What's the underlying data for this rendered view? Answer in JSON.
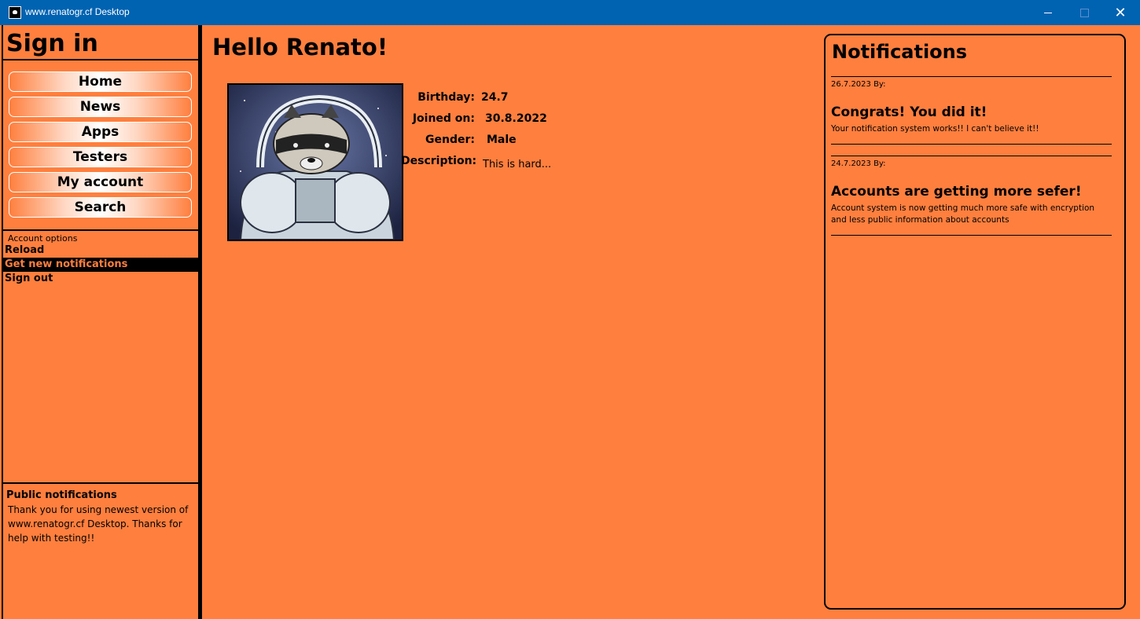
{
  "window": {
    "title": "www.renatogr.cf Desktop",
    "close_glyph": "✕"
  },
  "sidebar": {
    "heading": "Sign in",
    "nav": [
      {
        "label": "Home"
      },
      {
        "label": "News"
      },
      {
        "label": "Apps"
      },
      {
        "label": "Testers"
      },
      {
        "label": "My account"
      },
      {
        "label": "Search"
      }
    ],
    "account_options_label": "Account options",
    "account_menu": [
      {
        "label": "Reload",
        "active": false
      },
      {
        "label": "Get new notifications",
        "active": true
      },
      {
        "label": "Sign out",
        "active": false
      }
    ],
    "public_notifications": {
      "title": "Public notifications",
      "body": "Thank you for using newest version of www.renatogr.cf Desktop. Thanks for help with testing!!"
    }
  },
  "profile": {
    "greeting": "Hello Renato!",
    "avatar_icon": "raccoon-astronaut-avatar",
    "fields": [
      {
        "label": "Birthday:",
        "value": "24.7"
      },
      {
        "label": "Joined on:",
        "value": "30.8.2022"
      },
      {
        "label": "Gender:",
        "value": "Male"
      },
      {
        "label": "Description:",
        "value": "This is hard..."
      }
    ]
  },
  "notifications": {
    "title": "Notifications",
    "items": [
      {
        "meta": "26.7.2023 By:",
        "heading": "Congrats! You did it!",
        "body": "Your notification system works!! I can't believe it!!"
      },
      {
        "meta": "24.7.2023 By:",
        "heading": "Accounts are getting more sefer!",
        "body": "Account system is now getting much more safe with encryption and less public information about accounts"
      }
    ]
  },
  "colors": {
    "background": "#ff7f3f",
    "titlebar": "#0063b1",
    "active_menu_bg": "#000000",
    "active_menu_text": "#ff7f3f"
  }
}
